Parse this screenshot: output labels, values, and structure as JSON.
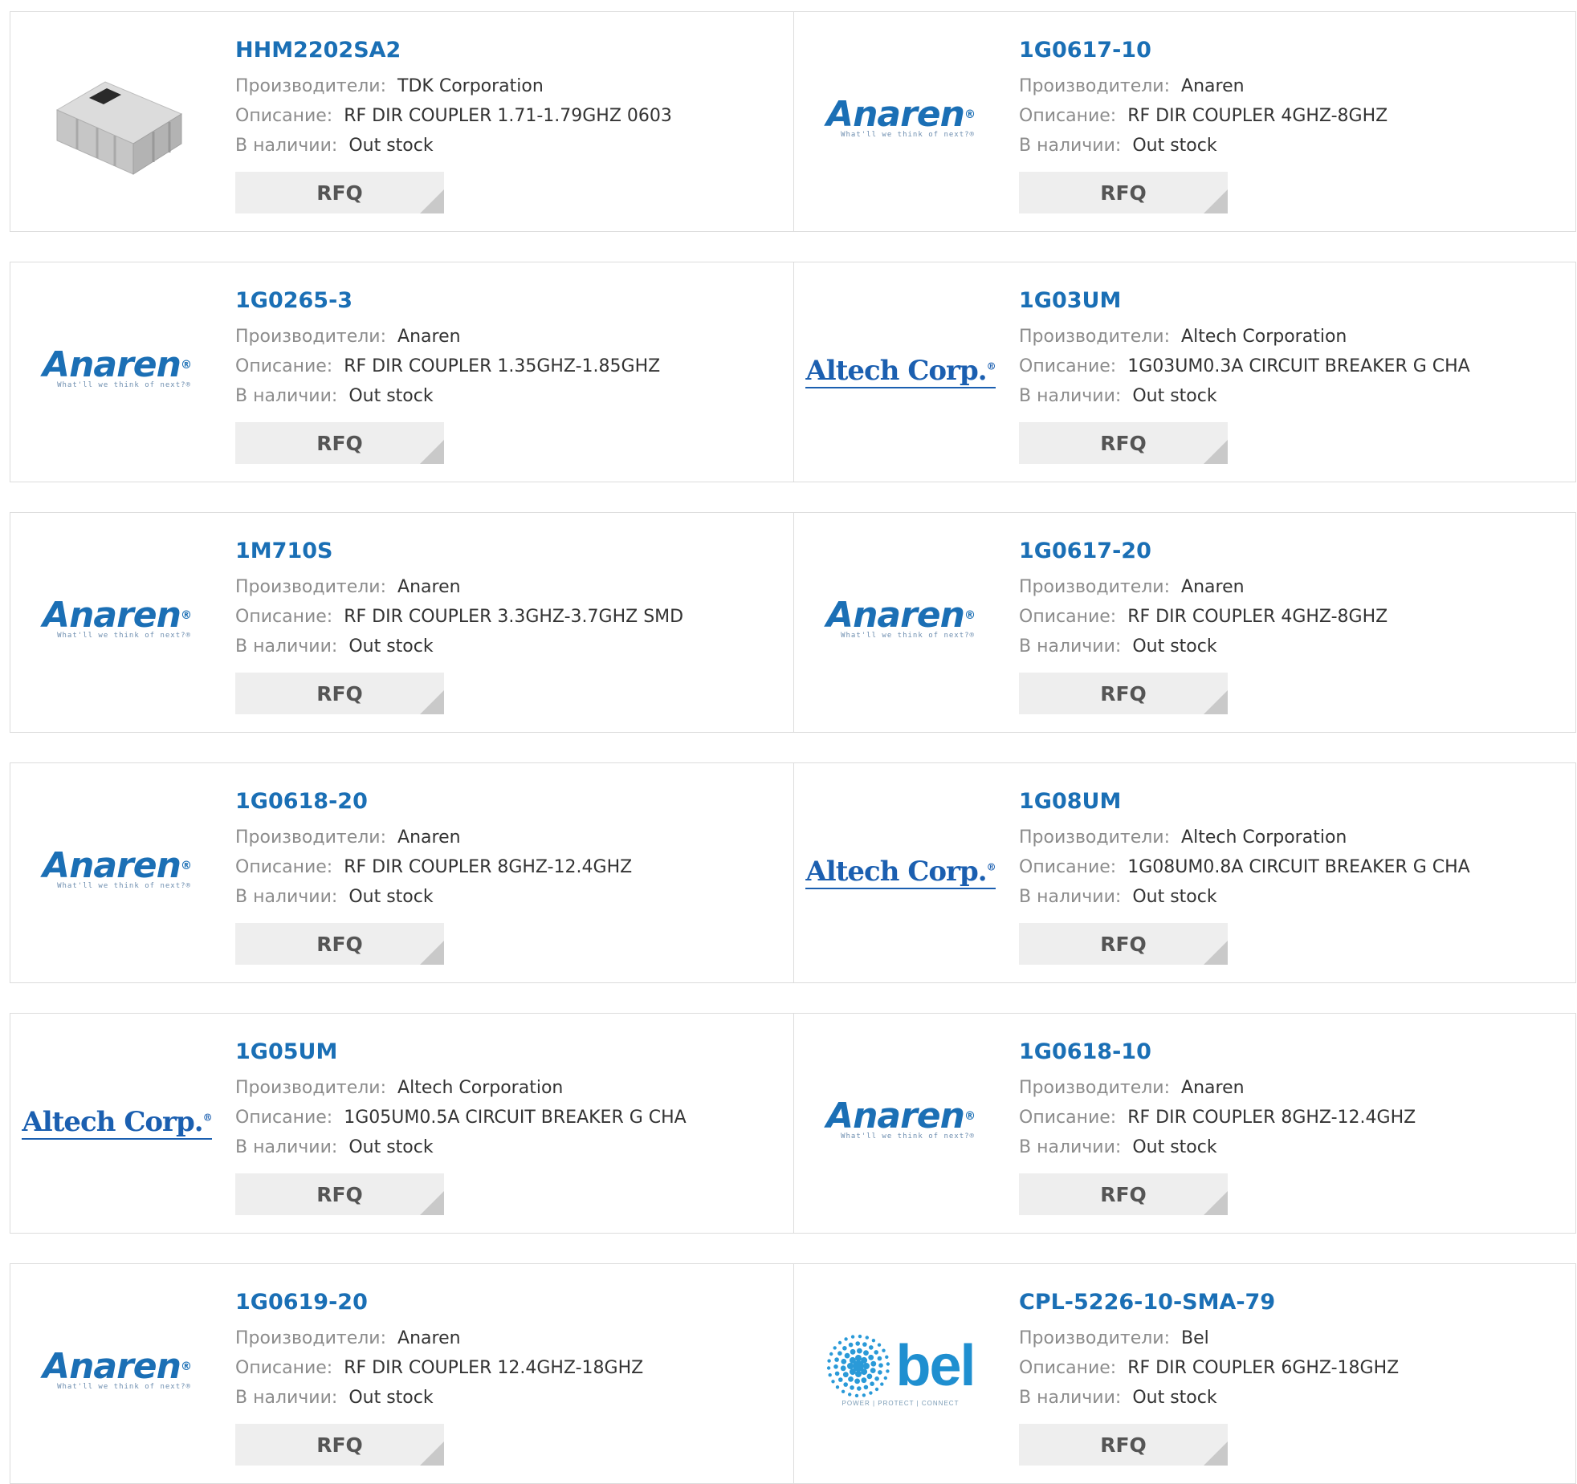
{
  "labels": {
    "manufacturer": "Производители:",
    "description": "Описание:",
    "availability": "В наличии:",
    "rfq": "RFQ"
  },
  "brand_logos": {
    "anaren": {
      "word": "Anaren",
      "mark": "®",
      "tagline": "What'll we think of next?®"
    },
    "altech": {
      "word": "Altech Corp.",
      "mark": "®"
    },
    "bel": {
      "word": "bel",
      "tagline": "POWER | PROTECT | CONNECT"
    }
  },
  "products": [
    {
      "part": "HHM2202SA2",
      "manufacturer": "TDK Corporation",
      "description": "RF DIR COUPLER 1.71-1.79GHZ 0603",
      "stock": "Out stock",
      "image": "chip-component-photo"
    },
    {
      "part": "1G0617-10",
      "manufacturer": "Anaren",
      "description": "RF DIR COUPLER 4GHZ-8GHZ",
      "stock": "Out stock",
      "image": "anaren-logo"
    },
    {
      "part": "1G0265-3",
      "manufacturer": "Anaren",
      "description": "RF DIR COUPLER 1.35GHZ-1.85GHZ",
      "stock": "Out stock",
      "image": "anaren-logo"
    },
    {
      "part": "1G03UM",
      "manufacturer": "Altech Corporation",
      "description": "1G03UM0.3A CIRCUIT BREAKER G CHA",
      "stock": "Out stock",
      "image": "altech-logo"
    },
    {
      "part": "1M710S",
      "manufacturer": "Anaren",
      "description": "RF DIR COUPLER 3.3GHZ-3.7GHZ SMD",
      "stock": "Out stock",
      "image": "anaren-logo"
    },
    {
      "part": "1G0617-20",
      "manufacturer": "Anaren",
      "description": "RF DIR COUPLER 4GHZ-8GHZ",
      "stock": "Out stock",
      "image": "anaren-logo"
    },
    {
      "part": "1G0618-20",
      "manufacturer": "Anaren",
      "description": "RF DIR COUPLER 8GHZ-12.4GHZ",
      "stock": "Out stock",
      "image": "anaren-logo"
    },
    {
      "part": "1G08UM",
      "manufacturer": "Altech Corporation",
      "description": "1G08UM0.8A CIRCUIT BREAKER G CHA",
      "stock": "Out stock",
      "image": "altech-logo"
    },
    {
      "part": "1G05UM",
      "manufacturer": "Altech Corporation",
      "description": "1G05UM0.5A CIRCUIT BREAKER G CHA",
      "stock": "Out stock",
      "image": "altech-logo"
    },
    {
      "part": "1G0618-10",
      "manufacturer": "Anaren",
      "description": "RF DIR COUPLER 8GHZ-12.4GHZ",
      "stock": "Out stock",
      "image": "anaren-logo"
    },
    {
      "part": "1G0619-20",
      "manufacturer": "Anaren",
      "description": "RF DIR COUPLER 12.4GHZ-18GHZ",
      "stock": "Out stock",
      "image": "anaren-logo"
    },
    {
      "part": "CPL-5226-10-SMA-79",
      "manufacturer": "Bel",
      "description": "RF DIR COUPLER 6GHZ-18GHZ",
      "stock": "Out stock",
      "image": "bel-logo"
    }
  ],
  "colors": {
    "part_link": "#1a6fb5",
    "label": "#8c8c8c",
    "value": "#333333",
    "rfq_bg": "#eeeeee",
    "border": "#dcdcdc"
  }
}
